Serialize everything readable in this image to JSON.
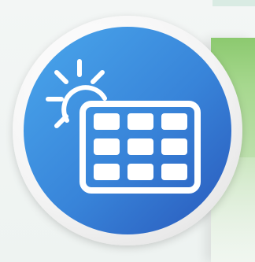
{
  "icon": {
    "name": "solar-panel-icon",
    "subicons": [
      "sun-icon",
      "solar-panel-grid-icon"
    ]
  },
  "colors": {
    "outer_ring": "#f7f7f7",
    "inner_circle_start": "#47a4eb",
    "inner_circle_end": "#2a62c3",
    "icon_white": "#ffffff",
    "background_panel_green": "#9bd27d"
  }
}
